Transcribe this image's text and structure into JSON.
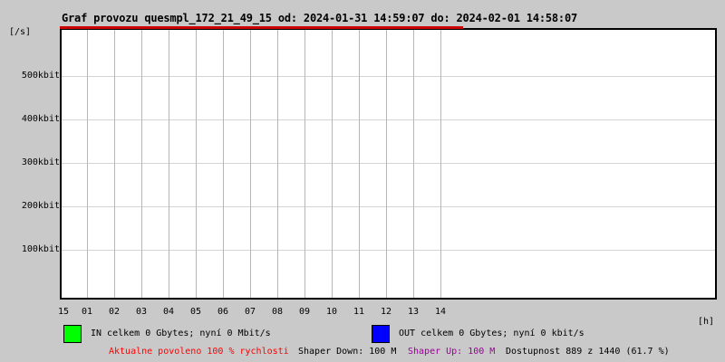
{
  "chart_data": {
    "type": "line",
    "title": "Graf provozu quesmpl_172_21_49_15 od: 2024-01-31 14:59:07 do: 2024-02-01 14:58:07",
    "ylabel": "[/s]",
    "xlabel": "[h]",
    "grid": true,
    "legend_position": "bottom",
    "ylim_kbit": [
      0,
      615
    ],
    "y_ticks": [
      {
        "label": "500kbit",
        "value": 500
      },
      {
        "label": "400kbit",
        "value": 400
      },
      {
        "label": "300kbit",
        "value": 300
      },
      {
        "label": "200kbit",
        "value": 200
      },
      {
        "label": "100kbit",
        "value": 100
      }
    ],
    "x_ticks": [
      "15",
      "01",
      "02",
      "03",
      "04",
      "05",
      "06",
      "07",
      "08",
      "09",
      "10",
      "11",
      "12",
      "13",
      "14"
    ],
    "series": [
      {
        "name": "IN",
        "color": "#00ff00",
        "total": "0 Gbytes",
        "current": "0 Mbit/s",
        "values_kbit": [
          0,
          0,
          0,
          0,
          0,
          0,
          0,
          0,
          0,
          0,
          0,
          0,
          0,
          0,
          0
        ]
      },
      {
        "name": "OUT",
        "color": "#0000ff",
        "total": "0 Gbytes",
        "current": "0 kbit/s",
        "values_kbit": [
          0,
          0,
          0,
          0,
          0,
          0,
          0,
          0,
          0,
          0,
          0,
          0,
          0,
          0,
          0
        ]
      }
    ],
    "availability": {
      "minutes_up": 889,
      "minutes_total": 1440,
      "percent": 61.7,
      "bar_color": "#cc0000"
    }
  },
  "legend": {
    "in_label": "IN celkem 0 Gbytes; nyní 0 Mbit/s",
    "out_label": "OUT celkem 0 Gbytes; nyní 0 kbit/s"
  },
  "footer": {
    "allowed": "Aktualne povoleno 100 % rychlosti",
    "shaper_down": "Shaper Down: 100 M",
    "shaper_up": "Shaper Up: 100 M",
    "availability": "Dostupnost 889 z 1440 (61.7 %)"
  },
  "colors": {
    "background": "#c9c9c9",
    "plot_background": "#ffffff",
    "border": "#000000",
    "availability_bar": "#cc0000",
    "allowed_text": "#ff0000",
    "shaper_up_text": "#990099",
    "in_series": "#00ff00",
    "out_series": "#0000ff"
  }
}
